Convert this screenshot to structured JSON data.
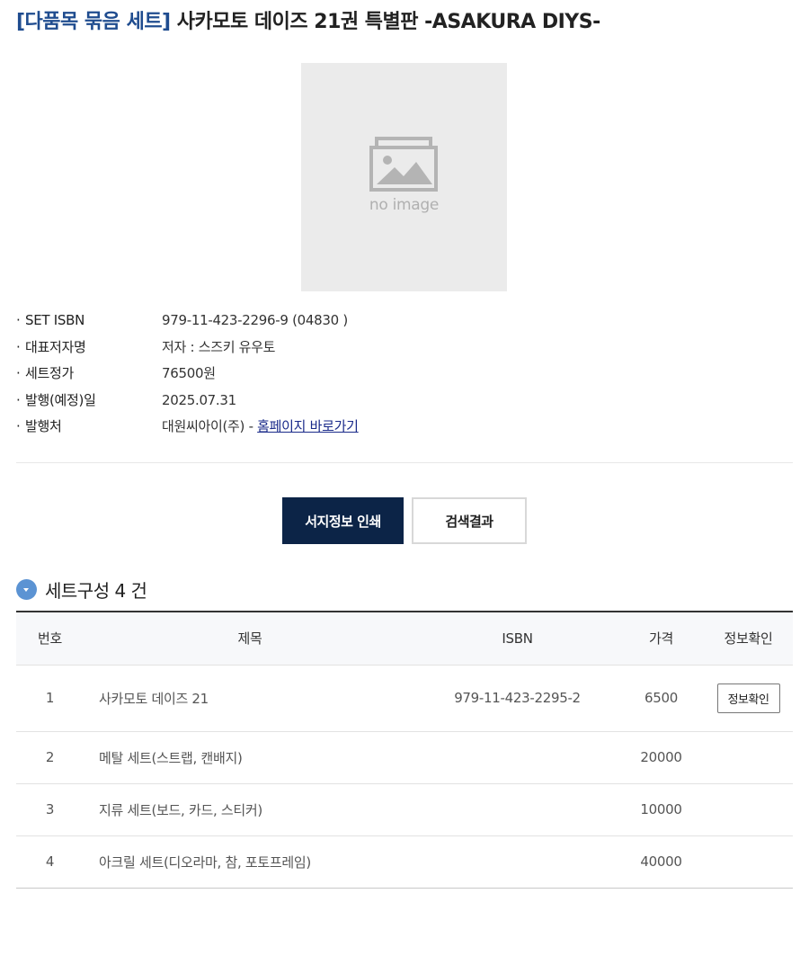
{
  "header": {
    "tag": "[다품목 묶음 세트]",
    "title": "사카모토 데이즈 21권 특별판 -ASAKURA DIYS-"
  },
  "cover": {
    "placeholder_text": "no image",
    "icon": "image-placeholder-icon"
  },
  "info": [
    {
      "label": "SET ISBN",
      "value": "979-11-423-2296-9 (04830 )"
    },
    {
      "label": "대표저자명",
      "value": "저자 : 스즈키 유우토"
    },
    {
      "label": "세트정가",
      "value": "76500원"
    },
    {
      "label": "발행(예정)일",
      "value": "2025.07.31"
    },
    {
      "label": "발행처",
      "value": "대원씨아이(주) - ",
      "link": "홈페이지 바로가기"
    }
  ],
  "buttons": {
    "print": "서지정보 인쇄",
    "results": "검색결과"
  },
  "section": {
    "title": "세트구성 4 건"
  },
  "table": {
    "headers": [
      "번호",
      "제목",
      "ISBN",
      "가격",
      "정보확인"
    ],
    "rows": [
      {
        "no": "1",
        "title": "사카모토 데이즈 21",
        "isbn": "979-11-423-2295-2",
        "price": "6500",
        "action": "정보확인"
      },
      {
        "no": "2",
        "title": "메탈 세트(스트랩, 캔배지)",
        "isbn": "",
        "price": "20000",
        "action": ""
      },
      {
        "no": "3",
        "title": "지류 세트(보드, 카드, 스티커)",
        "isbn": "",
        "price": "10000",
        "action": ""
      },
      {
        "no": "4",
        "title": "아크릴 세트(디오라마, 참, 포토프레임)",
        "isbn": "",
        "price": "40000",
        "action": ""
      }
    ]
  },
  "colors": {
    "tag": "#1f4c8f",
    "primary_button": "#0c2447",
    "section_icon": "#5b93d3",
    "link": "#1a2a8a"
  }
}
